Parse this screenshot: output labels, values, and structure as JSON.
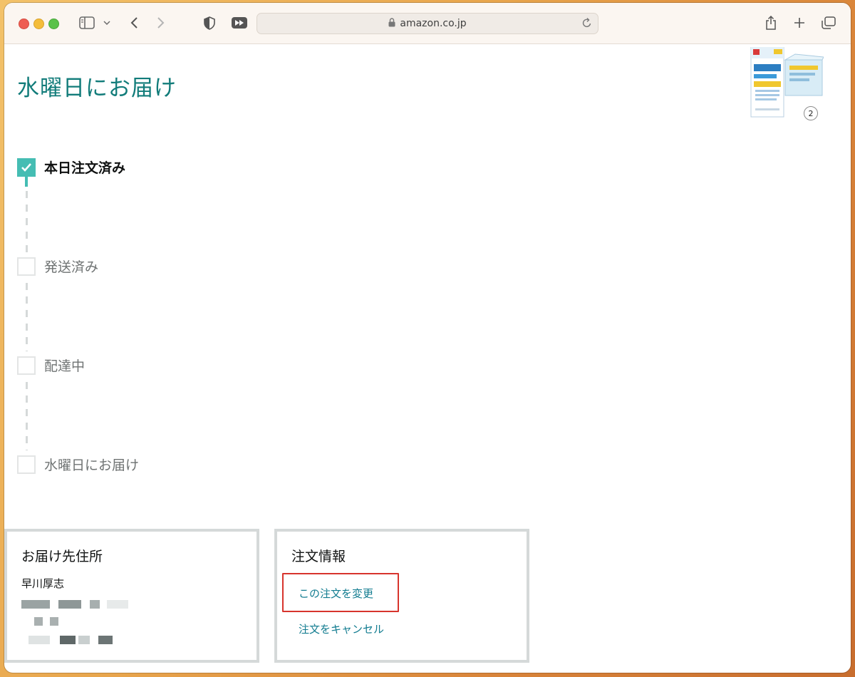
{
  "browser": {
    "url": "amazon.co.jp"
  },
  "page": {
    "title": "水曜日にお届け",
    "item_quantity": "2"
  },
  "tracker": {
    "steps": [
      {
        "label": "本日注文済み",
        "done": true
      },
      {
        "label": "発送済み",
        "done": false
      },
      {
        "label": "配達中",
        "done": false
      },
      {
        "label": "水曜日にお届け",
        "done": false
      }
    ]
  },
  "address_card": {
    "title": "お届け先住所",
    "recipient": "早川厚志"
  },
  "order_card": {
    "title": "注文情報",
    "change_link": "この注文を変更",
    "cancel_link": "注文をキャンセル"
  },
  "colors": {
    "accent": "#127c7a",
    "tracker_done": "#45bdb3",
    "link": "#127c90",
    "highlight": "#d7342d"
  }
}
